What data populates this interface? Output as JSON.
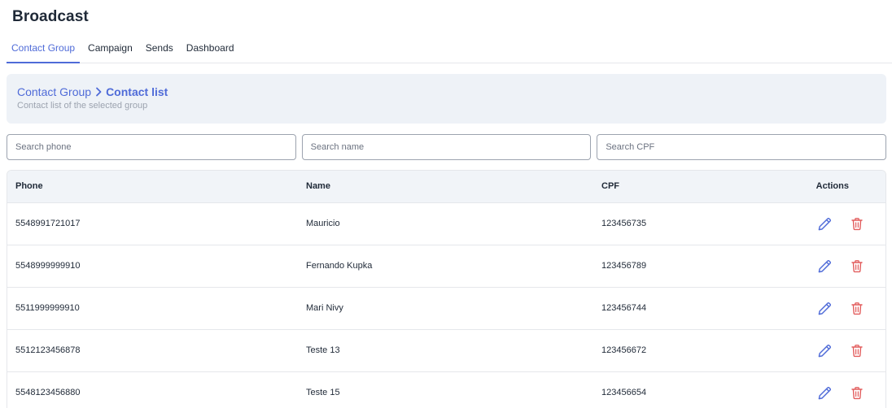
{
  "page": {
    "title": "Broadcast"
  },
  "tabs": [
    {
      "label": "Contact Group",
      "active": true
    },
    {
      "label": "Campaign",
      "active": false
    },
    {
      "label": "Sends",
      "active": false
    },
    {
      "label": "Dashboard",
      "active": false
    }
  ],
  "breadcrumb": {
    "parent": "Contact Group",
    "current": "Contact list",
    "subtitle": "Contact list of the selected group"
  },
  "filters": {
    "phone_placeholder": "Search phone",
    "name_placeholder": "Search name",
    "cpf_placeholder": "Search CPF"
  },
  "table": {
    "headers": {
      "phone": "Phone",
      "name": "Name",
      "cpf": "CPF",
      "actions": "Actions"
    },
    "rows": [
      {
        "phone": "5548991721017",
        "name": "Mauricio",
        "cpf": "123456735"
      },
      {
        "phone": "5548999999910",
        "name": "Fernando Kupka",
        "cpf": "123456789"
      },
      {
        "phone": "5511999999910",
        "name": "Mari Nivy",
        "cpf": "123456744"
      },
      {
        "phone": "5512123456878",
        "name": "Teste 13",
        "cpf": "123456672"
      },
      {
        "phone": "5548123456880",
        "name": "Teste 15",
        "cpf": "123456654"
      }
    ]
  },
  "icons": {
    "edit": "pencil-icon",
    "delete": "trash-icon",
    "separator": "chevron-right-icon"
  },
  "colors": {
    "accent": "#4f6bd8",
    "danger": "#e25c5c",
    "banner_bg": "#eef2f7",
    "header_bg": "#f1f4f8"
  }
}
